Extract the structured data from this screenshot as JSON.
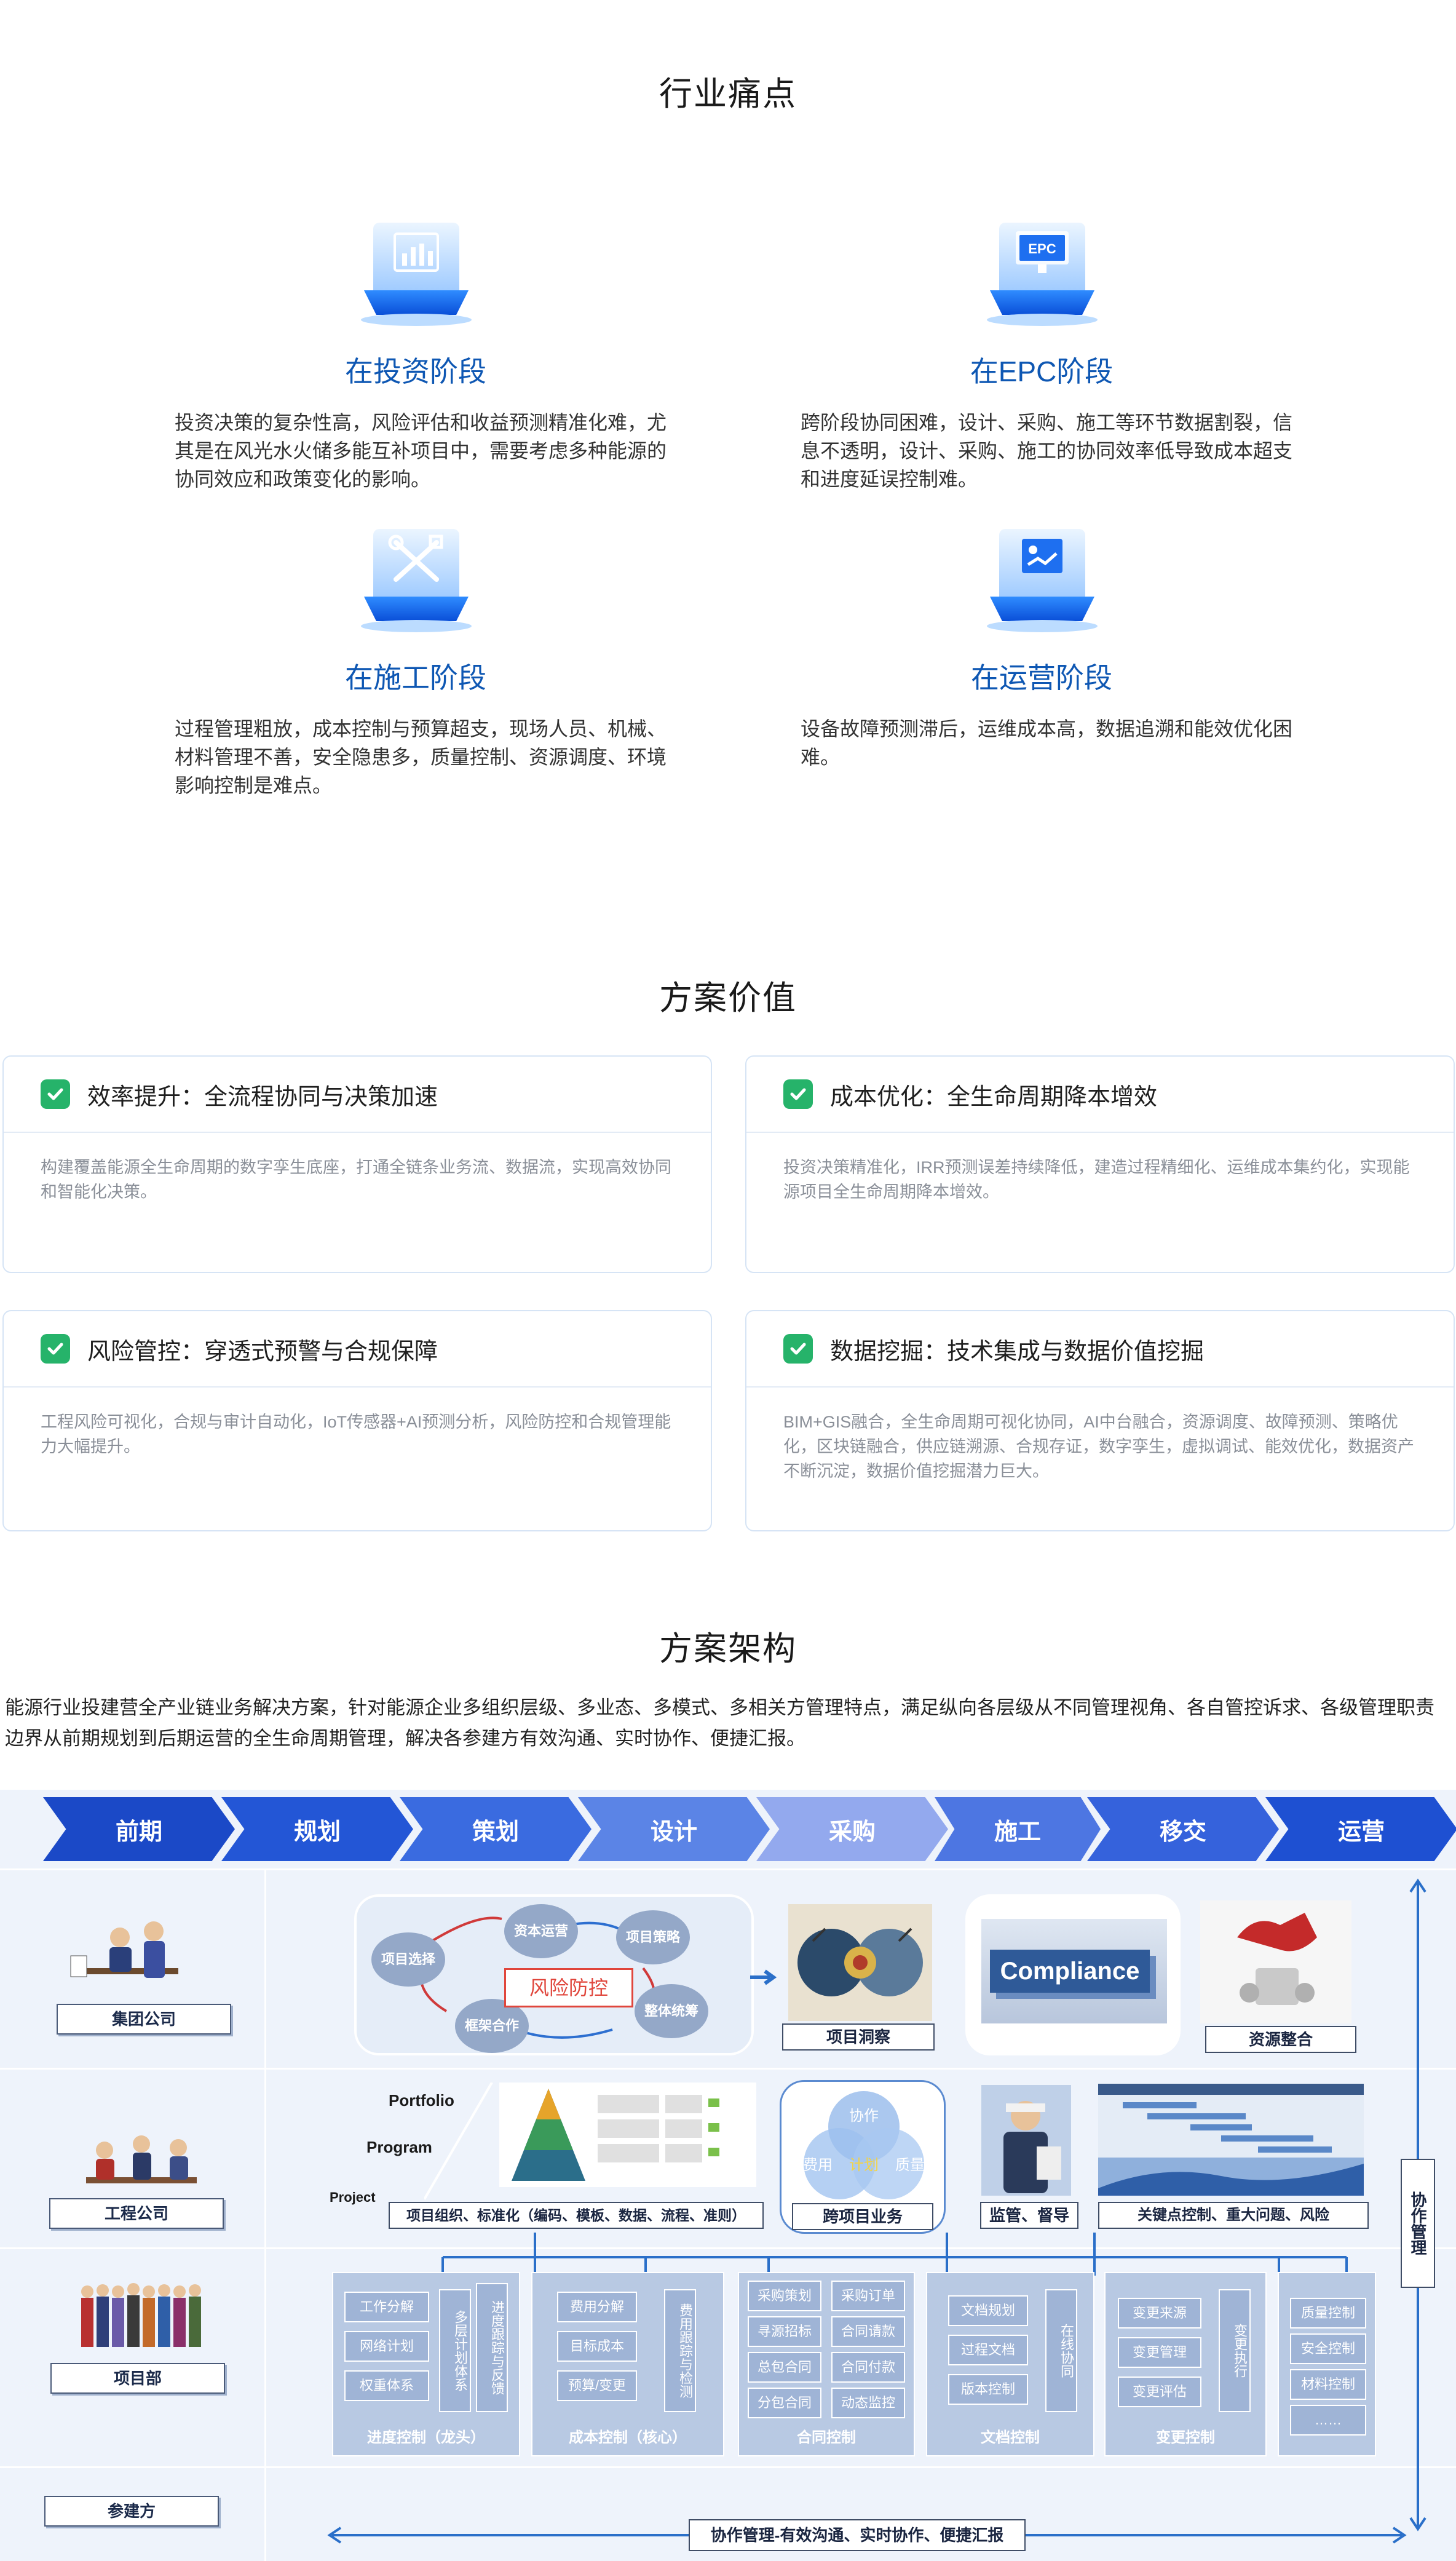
{
  "pain": {
    "title": "行业痛点",
    "items": [
      {
        "title": "在投资阶段",
        "text": "投资决策的复杂性高，风险评估和收益预测精准化难，尤其是在风光水火储多能互补项目中，需要考虑多种能源的协同效应和政策变化的影响。",
        "icon": "chart-icon"
      },
      {
        "title": "在EPC阶段",
        "text": "跨阶段协同困难，设计、采购、施工等环节数据割裂，信息不透明，设计、采购、施工的协同效率低导致成本超支和进度延误控制难。",
        "icon": "epc-monitor-icon",
        "icon_text": "EPC"
      },
      {
        "title": "在施工阶段",
        "text": "过程管理粗放，成本控制与预算超支，现场人员、机械、材料管理不善，安全隐患多，质量控制、资源调度、环境影响控制是难点。",
        "icon": "tools-icon"
      },
      {
        "title": "在运营阶段",
        "text": "设备故障预测滞后，运维成本高，数据追溯和能效优化困难。",
        "icon": "operation-icon"
      }
    ]
  },
  "value": {
    "title": "方案价值",
    "cards": [
      {
        "label": "效率提升：全流程协同与决策加速",
        "text": "构建覆盖能源全生命周期的数字孪生底座，打通全链条业务流、数据流，实现高效协同和智能化决策。"
      },
      {
        "label": "成本优化：全生命周期降本增效",
        "text": "投资决策精准化，IRR预测误差持续降低，建造过程精细化、运维成本集约化，实现能源项目全生命周期降本增效。"
      },
      {
        "label": "风险管控：穿透式预警与合规保障",
        "text": "工程风险可视化，合规与审计自动化，IoT传感器+AI预测分析，风险防控和合规管理能力大幅提升。"
      },
      {
        "label": "数据挖掘：技术集成与数据价值挖掘",
        "text": "BIM+GIS融合，全生命周期可视化协同，AI中台融合，资源调度、故障预测、策略优化，区块链融合，供应链溯源、合规存证，数字孪生，虚拟调试、能效优化，数据资产不断沉淀，数据价值挖掘潜力巨大。"
      }
    ]
  },
  "arch": {
    "title": "方案架构",
    "intro": "能源行业投建营全产业链业务解决方案，针对能源企业多组织层级、多业态、多模式、多相关方管理特点，满足纵向各层级从不同管理视角、各自管控诉求、各级管理职责边界从前期规划到后期运营的全生命周期管理，解决各参建方有效沟通、实时协作、便捷汇报。",
    "phases": [
      "前期",
      "规划",
      "策划",
      "设计",
      "采购",
      "施工",
      "移交",
      "运营"
    ],
    "phase_colors": [
      "#1b49c7",
      "#2356d6",
      "#3a6be0",
      "#5b84e6",
      "#93a9ee",
      "#4d76e2",
      "#3562dc",
      "#1e50d2"
    ],
    "lanes": [
      "集团公司",
      "工程公司",
      "项目部",
      "参建方"
    ],
    "group": {
      "bubbles": [
        "项目选择",
        "资本运营",
        "项目策略",
        "整体统筹",
        "框架合作"
      ],
      "risk": "风险防控",
      "insight": "项目洞察",
      "compliance": "Compliance",
      "resource": "资源整合"
    },
    "company": {
      "portfolio": "Portfolio",
      "program": "Program",
      "project": "Project",
      "std": "项目组织、标准化（编码、模板、数据、流程、准则）",
      "venn": [
        "协作",
        "费用",
        "质量",
        "计划"
      ],
      "cross": "跨项目业务",
      "supervise": "监管、督导",
      "keypoint": "关键点控制、重大问题、风险"
    },
    "columns": [
      {
        "title": "进度控制（龙头）",
        "items": [
          "工作分解",
          "网络计划",
          "权重体系"
        ],
        "tall": [
          "多层计划体系",
          "进度跟踪与反馈"
        ]
      },
      {
        "title": "成本控制（核心）",
        "items": [
          "费用分解",
          "目标成本",
          "预算/变更"
        ],
        "tall": [
          "费用跟踪与检测"
        ]
      },
      {
        "title": "合同控制",
        "items": [
          "采购策划",
          "寻源招标",
          "总包合同",
          "分包合同",
          "采购订单",
          "合同请款",
          "合同付款",
          "动态监控"
        ],
        "tall": []
      },
      {
        "title": "文档控制",
        "items": [
          "文档规划",
          "过程文档",
          "版本控制"
        ],
        "tall": [
          "在线协同"
        ]
      },
      {
        "title": "变更控制",
        "items": [
          "变更来源",
          "变更管理",
          "变更评估"
        ],
        "tall": [
          "变更执行"
        ]
      },
      {
        "title": "",
        "items": [
          "质量控制",
          "安全控制",
          "材料控制",
          "……"
        ],
        "tall": []
      }
    ],
    "collab": "协作管理-有效沟通、实时协作、便捷汇报",
    "side": "协作管理"
  }
}
